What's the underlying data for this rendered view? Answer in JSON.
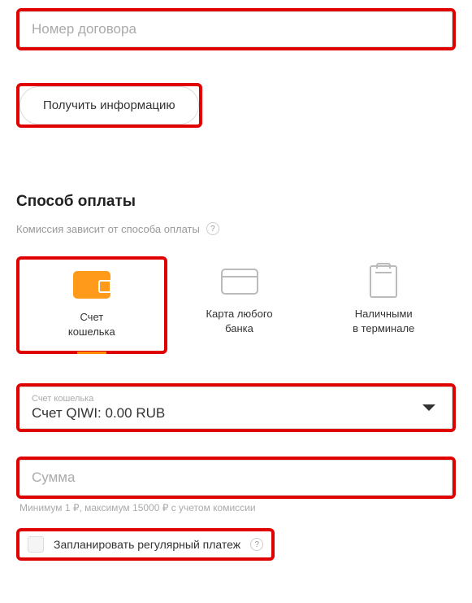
{
  "contract": {
    "placeholder": "Номер договора"
  },
  "buttons": {
    "get_info": "Получить информацию"
  },
  "payment_section": {
    "title": "Способ оплаты",
    "commission_note": "Комиссия зависит от способа оплаты",
    "help_glyph": "?"
  },
  "payment_methods": {
    "wallet": "Счет\nкошелька",
    "card": "Карта любого\nбанка",
    "terminal": "Наличными\nв терминале"
  },
  "account_select": {
    "label": "Счет кошелька",
    "value": "Счет QIWI: 0.00 RUB"
  },
  "amount": {
    "placeholder": "Сумма",
    "hint": "Минимум 1 ₽, максимум 15000 ₽ с учетом комиссии"
  },
  "schedule": {
    "label": "Запланировать регулярный платеж",
    "help_glyph": "?"
  }
}
